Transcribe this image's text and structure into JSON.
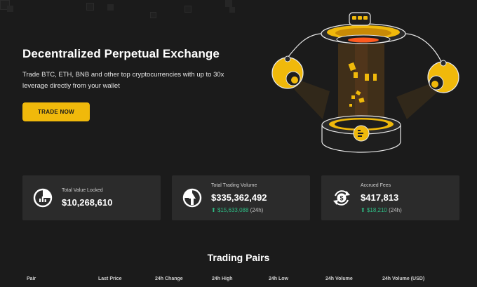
{
  "hero": {
    "title": "Decentralized Perpetual Exchange",
    "subtitle": "Trade BTC, ETH, BNB and other top cryptocurrencies with up to 30x leverage directly from your wallet",
    "cta_label": "TRADE NOW",
    "illustration": "ufo-beam-platform-illustration"
  },
  "stats": [
    {
      "label": "Total Value Locked",
      "value": "$10,268,610",
      "icon": "pie-chart-icon"
    },
    {
      "label": "Total Trading Volume",
      "value": "$335,362,492",
      "delta": "$15,633,088",
      "period": "(24h)",
      "icon": "volume-chart-icon"
    },
    {
      "label": "Accrued Fees",
      "value": "$417,813",
      "delta": "$18,210",
      "period": "(24h)",
      "icon": "dollar-cycle-icon"
    }
  ],
  "pairs": {
    "title": "Trading Pairs",
    "columns": [
      "Pair",
      "Last Price",
      "24h Change",
      "24h High",
      "24h Low",
      "24h Volume",
      "24h Volume (USD)"
    ]
  },
  "colors": {
    "background": "#1b1b1b",
    "card": "#2b2b2b",
    "accent": "#f0b90b",
    "positive": "#2ebd85"
  }
}
